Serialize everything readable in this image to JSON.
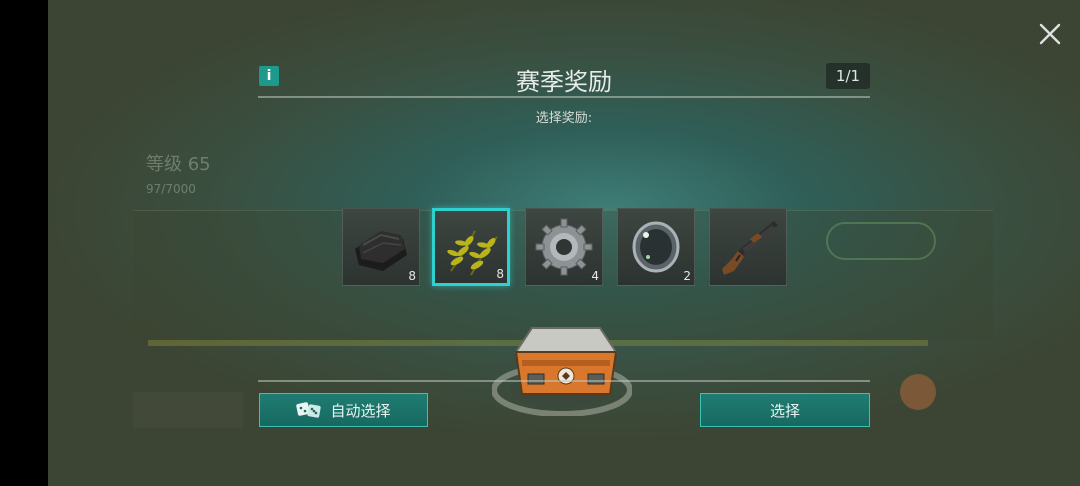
{
  "dialog": {
    "title": "赛季奖励",
    "counter": "1/1",
    "subtitle": "选择奖励:",
    "selected_index": 1,
    "rewards": [
      {
        "icon": "cloth-icon",
        "qty": "8"
      },
      {
        "icon": "fern-plant-icon",
        "qty": "8"
      },
      {
        "icon": "gear-icon",
        "qty": "4"
      },
      {
        "icon": "lens-icon",
        "qty": "2"
      },
      {
        "icon": "shotgun-icon",
        "qty": ""
      }
    ],
    "auto_select_label": "自动选择",
    "select_label": "选择"
  },
  "background": {
    "level": "等级 65",
    "progress": "97/7000"
  },
  "colors": {
    "accent": "#2ed1cf",
    "button": "#1f7c72"
  }
}
